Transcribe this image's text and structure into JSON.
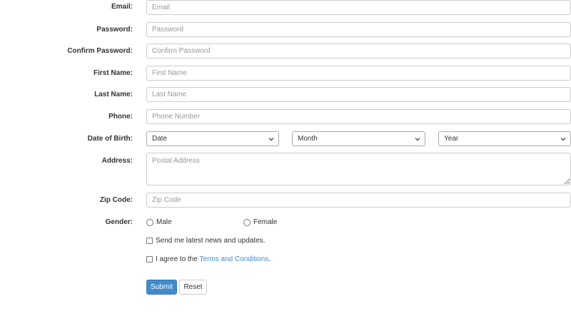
{
  "form": {
    "email": {
      "label": "Email:",
      "placeholder": "Email"
    },
    "password": {
      "label": "Password:",
      "placeholder": "Password"
    },
    "confirm_password": {
      "label": "Confirm Password:",
      "placeholder": "Confirm Password"
    },
    "first_name": {
      "label": "First Name:",
      "placeholder": "First Name"
    },
    "last_name": {
      "label": "Last Name:",
      "placeholder": "Last Name"
    },
    "phone": {
      "label": "Phone:",
      "placeholder": "Phone Number"
    },
    "dob": {
      "label": "Date of Birth:",
      "date": "Date",
      "month": "Month",
      "year": "Year"
    },
    "address": {
      "label": "Address:",
      "placeholder": "Postal Address"
    },
    "zip": {
      "label": "Zip Code:",
      "placeholder": "Zip Code"
    },
    "gender": {
      "label": "Gender:",
      "male": "Male",
      "female": "Female"
    },
    "newsletter": {
      "label": "Send me latest news and updates."
    },
    "terms": {
      "prefix": "I agree to the ",
      "link": "Terms and Conditions",
      "suffix": "."
    },
    "buttons": {
      "submit": "Submit",
      "reset": "Reset"
    }
  },
  "colors": {
    "primary": "#428bca",
    "link": "#428bca",
    "border": "#cccccc"
  },
  "icons": {
    "select_arrow": "chevron-down-icon"
  }
}
